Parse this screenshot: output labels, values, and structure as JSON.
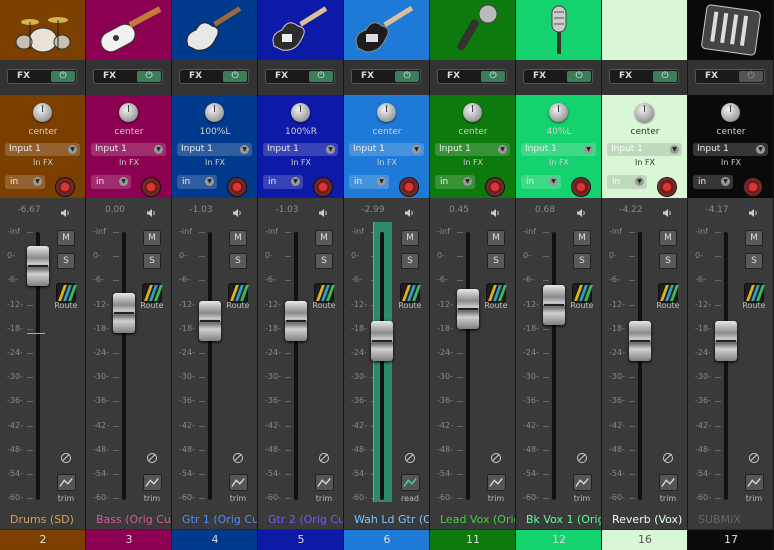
{
  "controls": {
    "fx_label": "FX",
    "input_label": "Input 1",
    "in_fx_label": "In FX",
    "monitor_label": "in",
    "mute_label": "M",
    "solo_label": "S",
    "route_label": "Route",
    "power_glyph": "⏻",
    "drop_glyph": "▼"
  },
  "scale": [
    "-inf",
    "0-",
    "-6-",
    "-12-",
    "-18-",
    "-24-",
    "-30-",
    "-36-",
    "-42-",
    "-48-",
    "-54-",
    "-60-"
  ],
  "tracks": [
    {
      "number": "2",
      "name": "Drums (SD)",
      "pan": "center",
      "volume": "-6.67",
      "automation": "trim",
      "color": "#7b3f00",
      "name_color": "#d9a15a",
      "thumb_icon": "drum-kit-icon",
      "fx_enabled": true
    },
    {
      "number": "3",
      "name": "Bass (Orig Cut",
      "pan": "center",
      "volume": "0.00",
      "automation": "trim",
      "color": "#8b0050",
      "name_color": "#e0559e",
      "thumb_icon": "bass-guitar-icon",
      "fx_enabled": true
    },
    {
      "number": "4",
      "name": "Gtr 1 (Orig Cut",
      "pan": "100%L",
      "volume": "-1.03",
      "automation": "trim",
      "color": "#003a8c",
      "name_color": "#4d8cff",
      "thumb_icon": "electric-guitar-white-icon",
      "fx_enabled": true
    },
    {
      "number": "5",
      "name": "Gtr 2 (Orig Cut",
      "pan": "100%R",
      "volume": "-1.03",
      "automation": "trim",
      "color": "#0d1aa8",
      "name_color": "#6a5cff",
      "thumb_icon": "electric-guitar-dark-icon",
      "fx_enabled": true
    },
    {
      "number": "6",
      "name": "Wah Ld Gtr (O",
      "pan": "center",
      "volume": "-2.99",
      "automation": "read",
      "color": "#1e7ad6",
      "name_color": "#7cc4ff",
      "thumb_icon": "electric-guitar-black-icon",
      "fx_enabled": true
    },
    {
      "number": "11",
      "name": "Lead Vox (Orig",
      "pan": "center",
      "volume": "0.45",
      "automation": "trim",
      "color": "#0c7a0c",
      "name_color": "#3ed33e",
      "thumb_icon": "handheld-mic-icon",
      "fx_enabled": true
    },
    {
      "number": "12",
      "name": "Bk Vox 1 (Orig",
      "pan": "40%L",
      "volume": "0.68",
      "automation": "trim",
      "color": "#14d26e",
      "name_color": "#5cff9c",
      "thumb_icon": "studio-mic-icon",
      "fx_enabled": true
    },
    {
      "number": "16",
      "name": "Reverb (Vox)",
      "pan": "center",
      "volume": "-4.22",
      "automation": "trim",
      "color": "#d9f7d6",
      "name_color": "#e8ffe8",
      "thumb_icon": "blank-thumbnail",
      "fx_enabled": true
    },
    {
      "number": "17",
      "name": "SUBMIX",
      "pan": "center",
      "volume": "-4.17",
      "automation": "trim",
      "color": "#0a0a0a",
      "name_color": "#666666",
      "thumb_icon": "mixing-console-icon",
      "fx_enabled": false
    }
  ],
  "levels": [
    {
      "fader_db": "-2.5",
      "peak_db": "-19"
    },
    {
      "fader_db": "-14",
      "peak_db": ""
    },
    {
      "fader_db": "-16",
      "peak_db": ""
    },
    {
      "fader_db": "-16",
      "peak_db": ""
    },
    {
      "fader_db": "-21",
      "peak_db": ""
    },
    {
      "fader_db": "-13",
      "peak_db": ""
    },
    {
      "fader_db": "-12",
      "peak_db": ""
    },
    {
      "fader_db": "-21",
      "peak_db": ""
    },
    {
      "fader_db": "-21",
      "peak_db": ""
    }
  ]
}
